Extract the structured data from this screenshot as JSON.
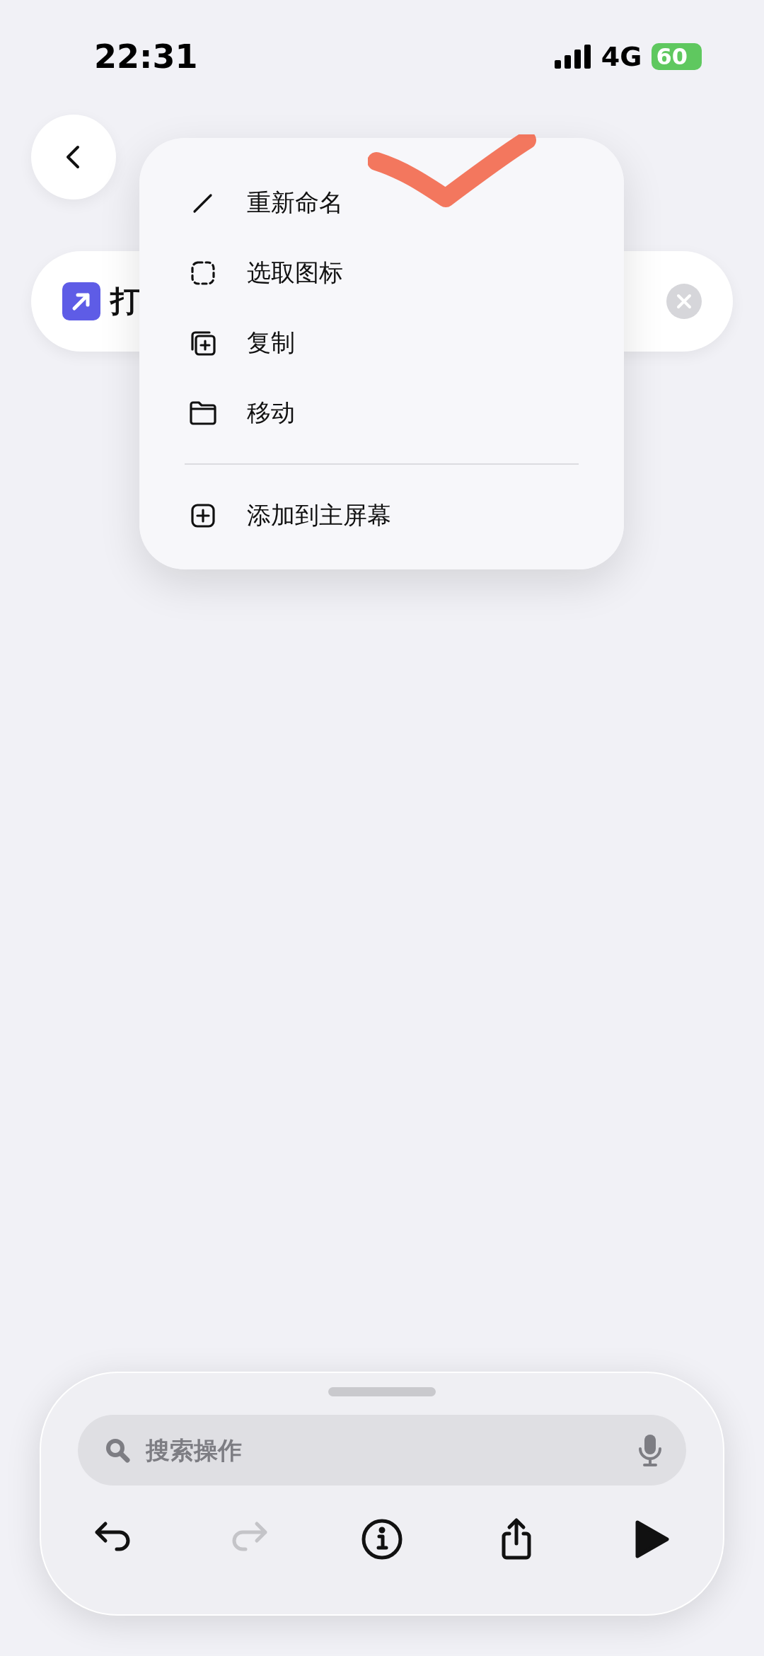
{
  "status_bar": {
    "time": "22:31",
    "network": "4G",
    "battery": "60"
  },
  "action": {
    "title": "打"
  },
  "menu": {
    "sections": [
      [
        {
          "kind": "rename",
          "label": "重新命名"
        },
        {
          "kind": "icon",
          "label": "选取图标"
        },
        {
          "kind": "duplicate",
          "label": "复制"
        },
        {
          "kind": "move",
          "label": "移动"
        }
      ],
      [
        {
          "kind": "home",
          "label": "添加到主屏幕"
        }
      ]
    ]
  },
  "search": {
    "placeholder": "搜索操作"
  },
  "toolbar": [
    {
      "kind": "undo",
      "disabled": false
    },
    {
      "kind": "redo",
      "disabled": true
    },
    {
      "kind": "info",
      "disabled": false
    },
    {
      "kind": "share",
      "disabled": false
    },
    {
      "kind": "play",
      "disabled": false
    }
  ]
}
